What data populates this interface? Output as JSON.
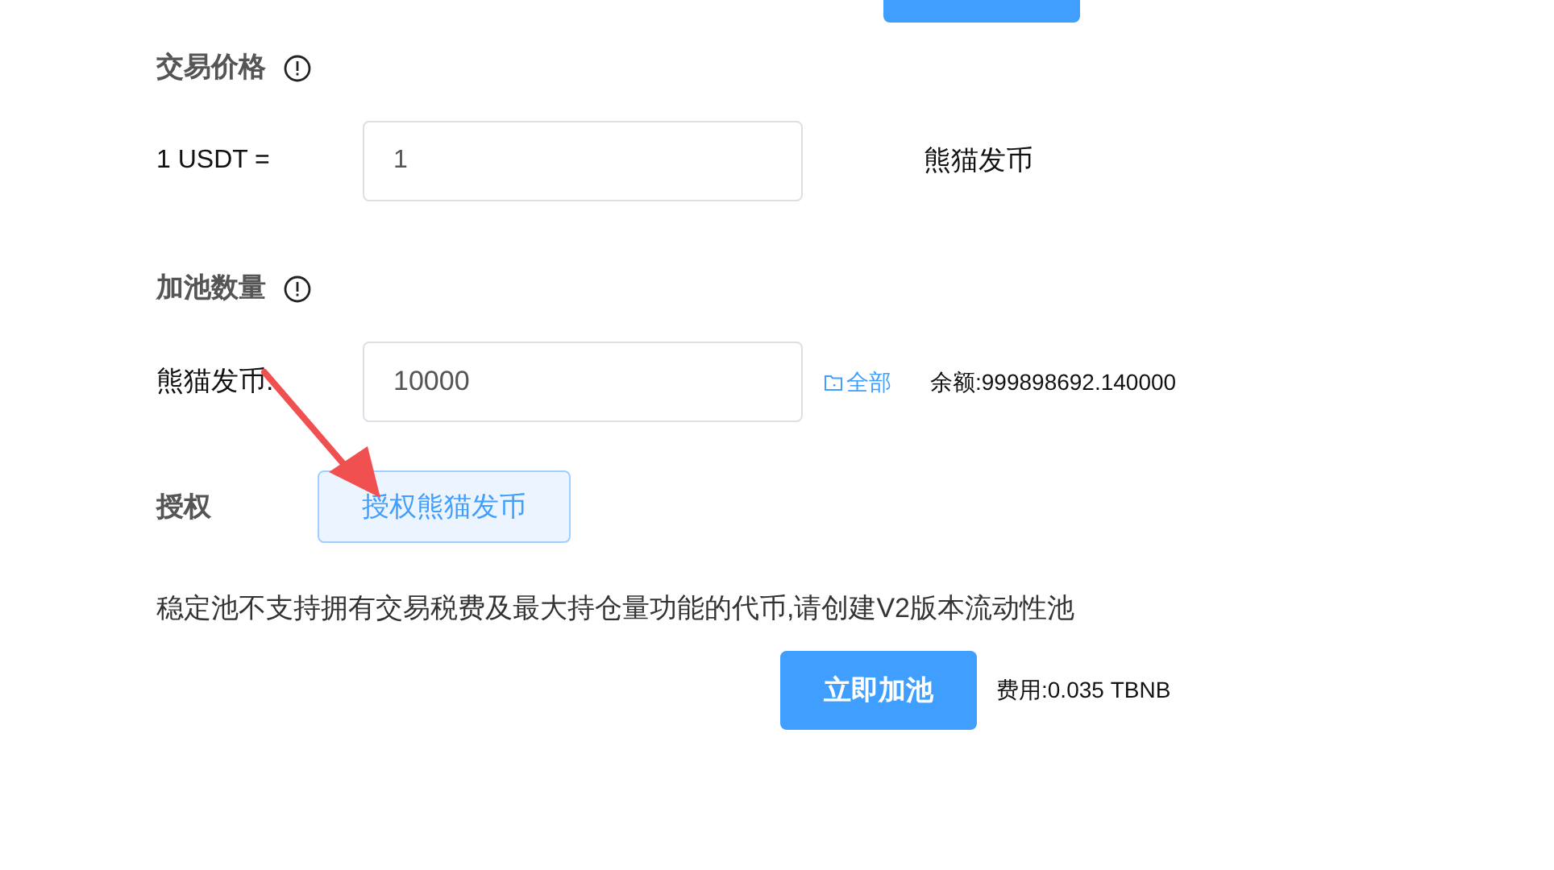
{
  "price_section": {
    "title": "交易价格",
    "label": "1 USDT =",
    "value": "1",
    "unit": "熊猫发币"
  },
  "amount_section": {
    "title": "加池数量",
    "label": "熊猫发币:",
    "value": "10000",
    "max_link": "全部",
    "balance": "余额:999898692.140000"
  },
  "authorize": {
    "label": "授权",
    "button": "授权熊猫发币"
  },
  "notice": "稳定池不支持拥有交易税费及最大持仓量功能的代币,请创建V2版本流动性池",
  "submit": {
    "button": "立即加池",
    "fee": "费用:0.035 TBNB"
  }
}
